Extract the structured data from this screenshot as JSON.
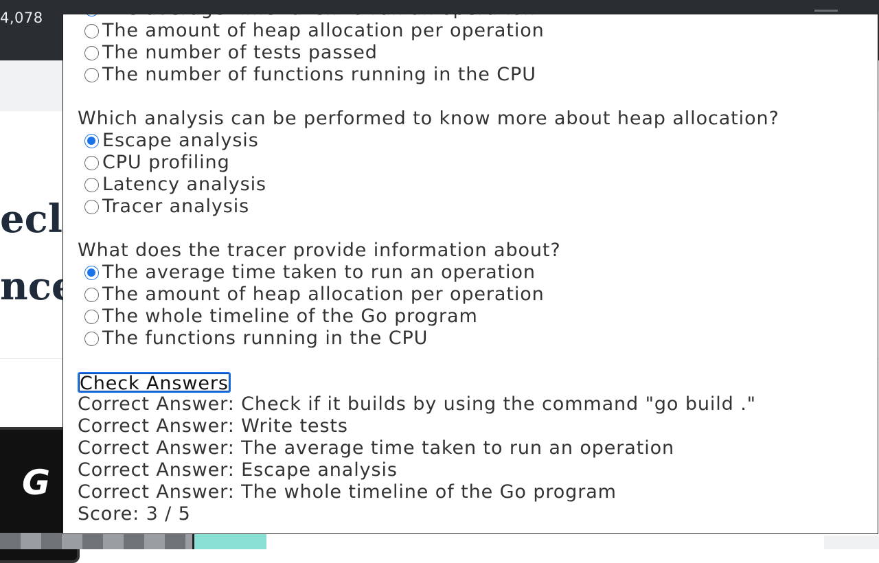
{
  "background": {
    "counter": "4,078",
    "heading_fragment_1": "ecl",
    "heading_fragment_2": "nce",
    "logo_text": "G"
  },
  "quiz": {
    "partial_question": {
      "options": [
        {
          "label": "The average time taken to run an operation",
          "checked": true
        },
        {
          "label": "The amount of heap allocation per operation",
          "checked": false
        },
        {
          "label": "The number of tests passed",
          "checked": false
        },
        {
          "label": "The number of functions running in the CPU",
          "checked": false
        }
      ]
    },
    "questions": [
      {
        "text": "Which analysis can be performed to know more about heap allocation?",
        "options": [
          {
            "label": "Escape analysis",
            "checked": true
          },
          {
            "label": "CPU profiling",
            "checked": false
          },
          {
            "label": "Latency analysis",
            "checked": false
          },
          {
            "label": "Tracer analysis",
            "checked": false
          }
        ]
      },
      {
        "text": "What does the tracer provide information about?",
        "options": [
          {
            "label": "The average time taken to run an operation",
            "checked": true
          },
          {
            "label": "The amount of heap allocation per operation",
            "checked": false
          },
          {
            "label": "The whole timeline of the Go program",
            "checked": false
          },
          {
            "label": "The functions running in the CPU",
            "checked": false
          }
        ]
      }
    ],
    "check_button_label": "Check Answers",
    "results": [
      "Correct Answer: Check if it builds by using the command \"go build .\"",
      "Correct Answer: Write tests",
      "Correct Answer: The average time taken to run an operation",
      "Correct Answer: Escape analysis",
      "Correct Answer: The whole timeline of the Go program"
    ],
    "score": "Score: 3 / 5"
  },
  "colors": {
    "accent": "#1a73e8",
    "topbar": "#2a2e33",
    "heading": "#1f2b3a"
  }
}
